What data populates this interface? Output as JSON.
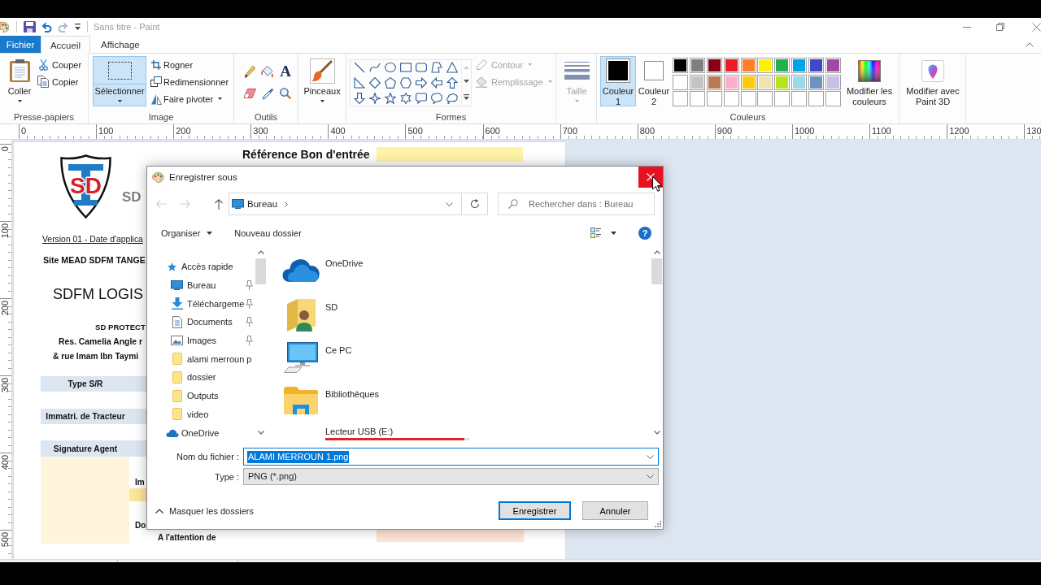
{
  "window": {
    "title": "Sans titre - Paint"
  },
  "tabs": [
    {
      "label": "Fichier",
      "kind": "file",
      "selected": false
    },
    {
      "label": "Accueil",
      "kind": "tab",
      "selected": true
    },
    {
      "label": "Affichage",
      "kind": "tab",
      "selected": false
    }
  ],
  "ribbon": {
    "clipboard": {
      "label": "Presse-papiers",
      "paste": "Coller",
      "cut": "Couper",
      "copy": "Copier"
    },
    "image": {
      "label": "Image",
      "select": {
        "label": "Sélectionner",
        "selected": true
      },
      "crop": "Rogner",
      "resize": "Redimensionner",
      "rotate": "Faire pivoter"
    },
    "tools": {
      "label": "Outils",
      "text_tool": "A"
    },
    "brushes": {
      "label": "Pinceaux"
    },
    "shapes": {
      "label": "Formes",
      "outline": {
        "label": "Contour",
        "disabled": true
      },
      "fill": {
        "label": "Remplissage",
        "disabled": true
      }
    },
    "size": {
      "label": "Taille",
      "disabled": true
    },
    "colors": {
      "label": "Couleurs",
      "slots": [
        {
          "label": "Couleur 1",
          "color": "#000000",
          "selected": true
        },
        {
          "label": "Couleur 2",
          "color": "#ffffff",
          "selected": false
        }
      ],
      "palette": [
        {
          "kind": "color",
          "color": "#000000"
        },
        {
          "kind": "color",
          "color": "#7f7f7f"
        },
        {
          "kind": "color",
          "color": "#880015"
        },
        {
          "kind": "color",
          "color": "#ed1c24"
        },
        {
          "kind": "color",
          "color": "#ff7f27"
        },
        {
          "kind": "color",
          "color": "#fff200"
        },
        {
          "kind": "color",
          "color": "#22b14c"
        },
        {
          "kind": "color",
          "color": "#00a2e8"
        },
        {
          "kind": "color",
          "color": "#3f48cc"
        },
        {
          "kind": "color",
          "color": "#a349a4"
        },
        {
          "kind": "color",
          "color": "#ffffff"
        },
        {
          "kind": "color",
          "color": "#c3c3c3"
        },
        {
          "kind": "color",
          "color": "#b97a57"
        },
        {
          "kind": "color",
          "color": "#ffaec9"
        },
        {
          "kind": "color",
          "color": "#ffc90e"
        },
        {
          "kind": "color",
          "color": "#efe4b0"
        },
        {
          "kind": "color",
          "color": "#b5e61d"
        },
        {
          "kind": "color",
          "color": "#99d9ea"
        },
        {
          "kind": "color",
          "color": "#7092be"
        },
        {
          "kind": "color",
          "color": "#c8bfe7"
        },
        {
          "kind": "empty"
        },
        {
          "kind": "empty"
        },
        {
          "kind": "empty"
        },
        {
          "kind": "empty"
        },
        {
          "kind": "empty"
        },
        {
          "kind": "empty"
        },
        {
          "kind": "empty"
        },
        {
          "kind": "empty"
        },
        {
          "kind": "empty"
        },
        {
          "kind": "empty"
        }
      ],
      "edit": "Modifier les couleurs"
    },
    "paint3d": "Modifier avec Paint 3D"
  },
  "ruler": {
    "horizontal": [
      "0",
      "100",
      "200",
      "300",
      "400",
      "500",
      "600",
      "700",
      "800",
      "900",
      "1000",
      "1100",
      "1200",
      "130"
    ],
    "vertical": [
      "0",
      "100",
      "200",
      "300",
      "400",
      "500"
    ]
  },
  "document": {
    "logo_text": "SD",
    "brand": "SD",
    "title": "Référence Bon d'entrée",
    "version": "Version 01 - Date d'applica",
    "site": "Site MEAD SDFM TANGE",
    "heading": "SDFM LOGIS",
    "address": [
      "SD PROTECT",
      "Res. Camelia Angle r",
      "& rue Imam Ibn Taymi"
    ],
    "fields": [
      "Type S/R",
      "Immatri. de Tracteur",
      "Signature Agent"
    ],
    "side_labels": [
      "Im",
      "Do"
    ],
    "attention": "A l'attention de"
  },
  "dialog": {
    "title": "Enregistrer sous",
    "close_hovered": true,
    "nav_buttons": [
      {
        "kind": "back",
        "disabled": true
      },
      {
        "kind": "forward",
        "disabled": true
      },
      {
        "kind": "up",
        "disabled": false
      }
    ],
    "location": "Bureau",
    "search": {
      "placeholder": "Rechercher dans : Bureau"
    },
    "toolbar": [
      {
        "label": "Organiser",
        "kind": "menu"
      },
      {
        "label": "Nouveau dossier",
        "kind": "button"
      }
    ],
    "help": "?",
    "tree": [
      {
        "label": "Accès rapide",
        "kind": "star",
        "children": [
          {
            "label": "Bureau",
            "kind": "desktop",
            "pinned": true
          },
          {
            "label": "Téléchargeme",
            "kind": "download",
            "pinned": true
          },
          {
            "label": "Documents",
            "kind": "documents",
            "pinned": true
          },
          {
            "label": "Images",
            "kind": "pictures",
            "pinned": true
          },
          {
            "label": "alami merroun p",
            "kind": "folder",
            "pinned": false
          },
          {
            "label": "dossier",
            "kind": "folder",
            "pinned": false
          },
          {
            "label": "Outputs",
            "kind": "folder",
            "pinned": false
          },
          {
            "label": "video",
            "kind": "folder",
            "pinned": false
          }
        ]
      },
      {
        "label": "OneDrive",
        "kind": "cloud"
      }
    ],
    "items": [
      {
        "name": "OneDrive",
        "kind": "cloud"
      },
      {
        "name": "SD",
        "kind": "user"
      },
      {
        "name": "Ce PC",
        "kind": "computer"
      },
      {
        "name": "Bibliothèques",
        "kind": "library"
      },
      {
        "name": "Lecteur USB (E:)",
        "kind": "drive",
        "level": 0.96
      }
    ],
    "file_name": {
      "label": "Nom du fichier :",
      "value": "ALAMI MERROUN 1.png",
      "highlighted": true
    },
    "file_type": {
      "label": "Type :",
      "value": "PNG (*.png)"
    },
    "hide_folders": "Masquer les dossiers",
    "buttons": [
      {
        "label": "Enregistrer",
        "default": true
      },
      {
        "label": "Annuler",
        "default": false
      }
    ]
  }
}
